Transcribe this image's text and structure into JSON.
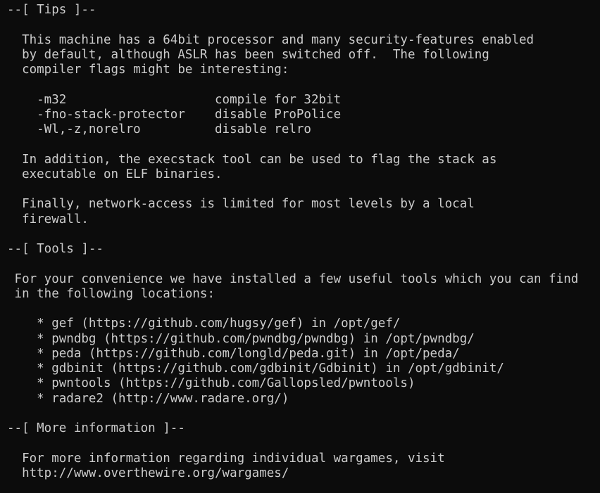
{
  "terminal": {
    "lines": [
      "--[ Tips ]--",
      "",
      "  This machine has a 64bit processor and many security-features enabled",
      "  by default, although ASLR has been switched off.  The following",
      "  compiler flags might be interesting:",
      "",
      "    -m32                    compile for 32bit",
      "    -fno-stack-protector    disable ProPolice",
      "    -Wl,-z,norelro          disable relro",
      "",
      "  In addition, the execstack tool can be used to flag the stack as",
      "  executable on ELF binaries.",
      "",
      "  Finally, network-access is limited for most levels by a local",
      "  firewall.",
      "",
      "--[ Tools ]--",
      "",
      " For your convenience we have installed a few useful tools which you can find",
      " in the following locations:",
      "",
      "    * gef (https://github.com/hugsy/gef) in /opt/gef/",
      "    * pwndbg (https://github.com/pwndbg/pwndbg) in /opt/pwndbg/",
      "    * peda (https://github.com/longld/peda.git) in /opt/peda/",
      "    * gdbinit (https://github.com/gdbinit/Gdbinit) in /opt/gdbinit/",
      "    * pwntools (https://github.com/Gallopsled/pwntools)",
      "    * radare2 (http://www.radare.org/)",
      "",
      "--[ More information ]--",
      "",
      "  For more information regarding individual wargames, visit",
      "  http://www.overthewire.org/wargames/"
    ]
  }
}
